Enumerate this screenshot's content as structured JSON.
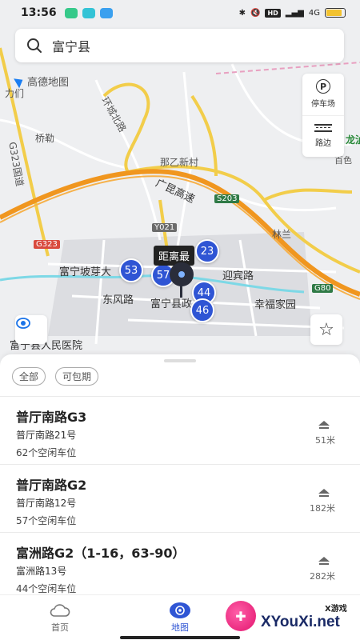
{
  "status_bar": {
    "time": "13:56",
    "hd": "HD",
    "net": "4G"
  },
  "search": {
    "query": "富宁县"
  },
  "map": {
    "brand": "高德地图",
    "labels": {
      "li_xing": "力们",
      "qiao_le": "桥勒",
      "huan_cheng_bei_lu": "环城北路",
      "g323_road": "G323国道",
      "na_yi_xin_cun": "那乙新村",
      "guang_kun_gao_su": "广昆高速",
      "lin_lan": "林兰",
      "fu_ning_po_ya_da": "富宁坡芽大",
      "ying_bin_lu": "迎宾路",
      "dong_feng_lu": "东风路",
      "fu_ning_xian_zheng": "富宁县政",
      "xing_fu_jia_yuan": "幸福家园",
      "hospital": "富宁县人民医院",
      "bai_se": "百色",
      "long_zhi": "龙沚"
    },
    "road_tags": {
      "g323": "G323",
      "s203": "S203",
      "y021": "Y021",
      "g80": "G80"
    },
    "side_panel": {
      "parking": "停车场",
      "parking_icon_letter": "P",
      "roadside": "路边"
    },
    "clusters": [
      "23",
      "53",
      "57",
      "44",
      "46"
    ],
    "tooltip": "距离最"
  },
  "filters": [
    "全部",
    "可包期"
  ],
  "parking_list": [
    {
      "title": "普厅南路G3",
      "address": "普厅南路21号",
      "spots": "62个空闲车位",
      "distance": "51米"
    },
    {
      "title": "普厅南路G2",
      "address": "普厅南路12号",
      "spots": "57个空闲车位",
      "distance": "182米"
    },
    {
      "title": "富洲路G2（1-16，63-90）",
      "address": "富洲路13号",
      "spots": "44个空闲车位",
      "distance": "282米"
    }
  ],
  "bottom_nav": {
    "home": "首页",
    "map": "地图"
  },
  "watermark": {
    "small": "X游戏",
    "big": "XYouXi.net"
  }
}
